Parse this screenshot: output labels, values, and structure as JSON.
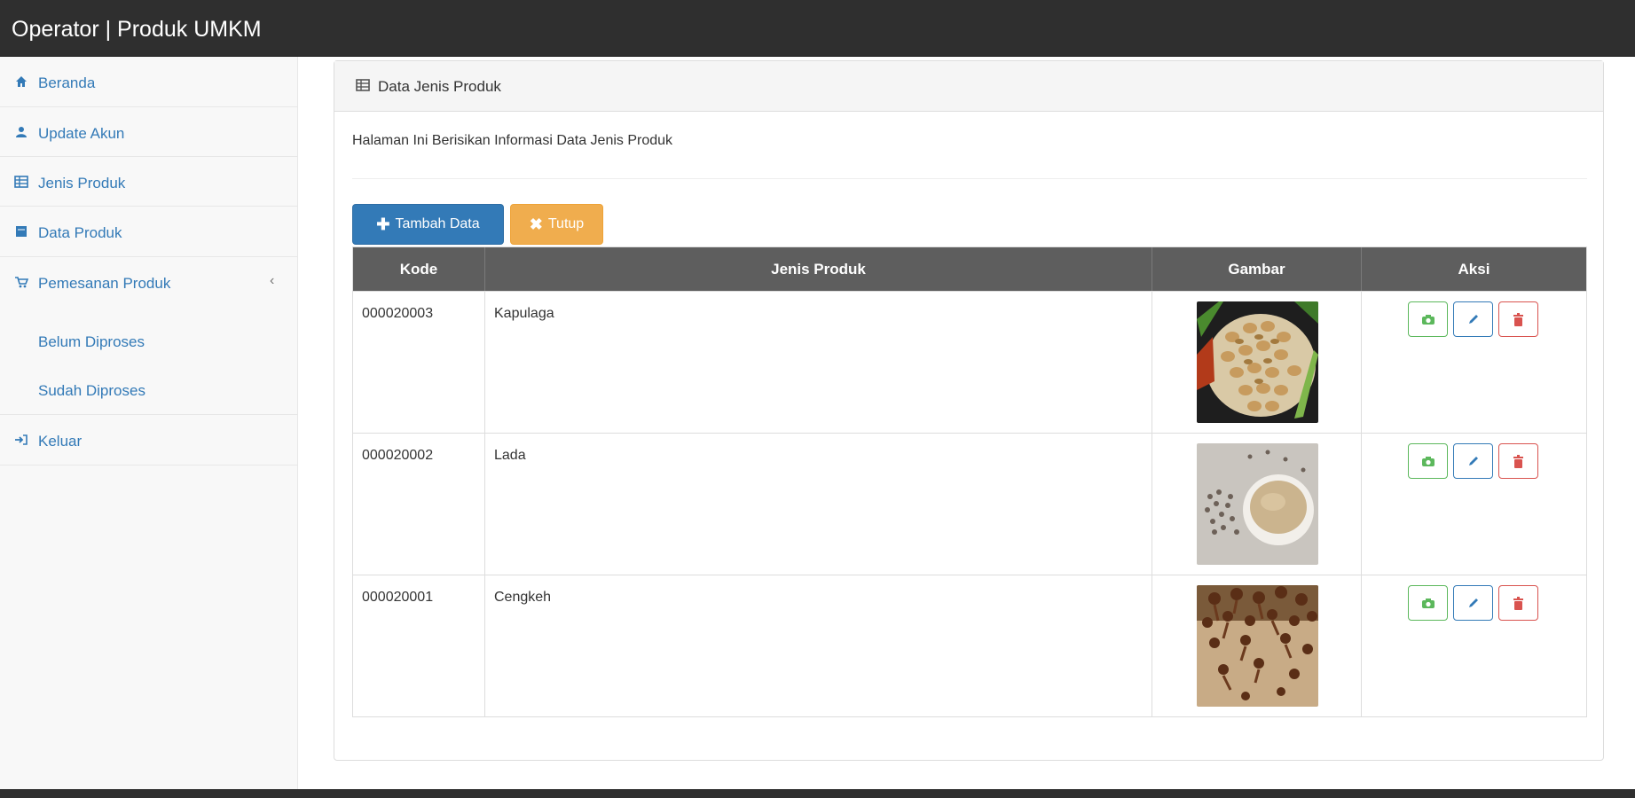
{
  "header": {
    "title": "Operator | Produk UMKM"
  },
  "sidebar": {
    "items": [
      {
        "label": "Beranda",
        "icon": "home-icon"
      },
      {
        "label": "Update Akun",
        "icon": "user-icon"
      },
      {
        "label": "Jenis Produk",
        "icon": "table-icon"
      },
      {
        "label": "Data Produk",
        "icon": "book-icon"
      },
      {
        "label": "Pemesanan Produk",
        "icon": "shopping-icon",
        "chevron": "‹"
      },
      {
        "label": "Belum Diproses"
      },
      {
        "label": "Sudah Diproses"
      },
      {
        "label": "Keluar",
        "icon": "logout-icon"
      }
    ]
  },
  "panel": {
    "title": "Data Jenis Produk",
    "intro": "Halaman Ini Berisikan Informasi Data Jenis Produk",
    "buttons": {
      "add": "Tambah Data",
      "close": "Tutup"
    }
  },
  "table": {
    "headers": [
      "Kode",
      "Jenis Produk",
      "Gambar",
      "Aksi"
    ],
    "rows": [
      {
        "kode": "000020003",
        "jenis": "Kapulaga"
      },
      {
        "kode": "000020002",
        "jenis": "Lada"
      },
      {
        "kode": "000020001",
        "jenis": "Cengkeh"
      }
    ]
  },
  "colors": {
    "topbar": "#2f2f2f",
    "primary": "#337ab7",
    "warning": "#f0ad4e",
    "success": "#5cb85c",
    "danger": "#d9534f",
    "table_header": "#5e5e5e"
  }
}
